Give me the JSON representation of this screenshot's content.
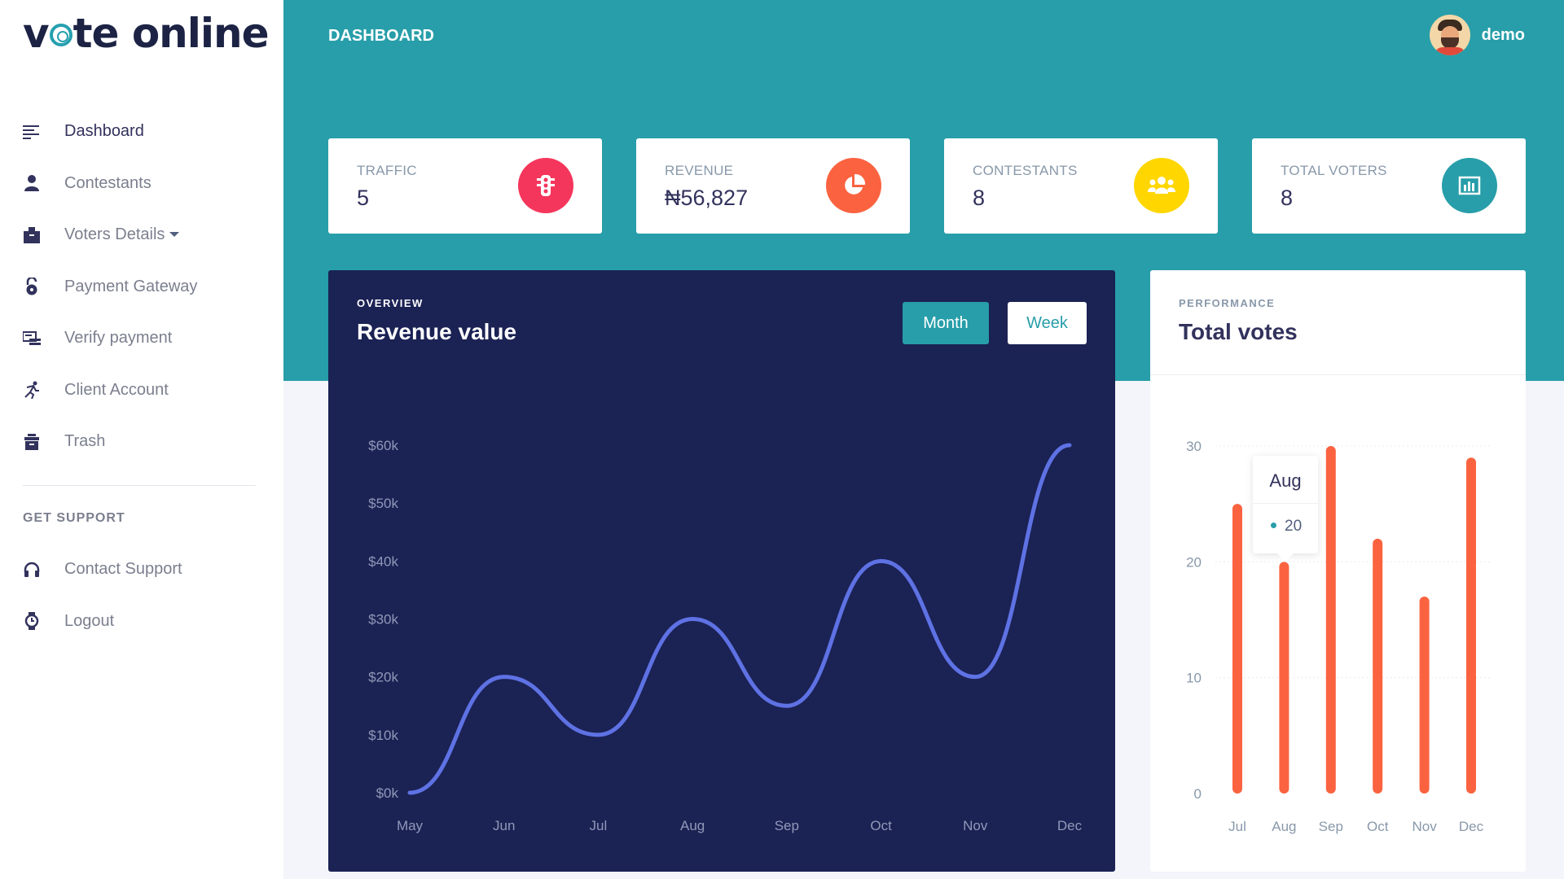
{
  "brand": {
    "prefix": "v",
    "suffix": "te online"
  },
  "sidebar": {
    "items": [
      {
        "label": "Dashboard",
        "icon": "list-icon"
      },
      {
        "label": "Contestants",
        "icon": "user-icon"
      },
      {
        "label": "Voters Details",
        "icon": "inbox-icon"
      },
      {
        "label": "Payment Gateway",
        "icon": "lock-icon"
      },
      {
        "label": "Verify payment",
        "icon": "money-check-icon"
      },
      {
        "label": "Client Account",
        "icon": "running-icon"
      },
      {
        "label": "Trash",
        "icon": "archive-icon"
      }
    ],
    "support_heading": "GET SUPPORT",
    "support_items": [
      {
        "label": "Contact Support",
        "icon": "headphones-icon"
      },
      {
        "label": "Logout",
        "icon": "watch-icon"
      }
    ]
  },
  "header": {
    "title": "DASHBOARD",
    "username": "demo"
  },
  "stats": [
    {
      "title": "TRAFFIC",
      "value": "5",
      "color": "#f5365c",
      "icon": "traffic-light-icon"
    },
    {
      "title": "REVENUE",
      "value": "₦56,827",
      "color": "#fb6340",
      "icon": "pie-chart-icon"
    },
    {
      "title": "CONTESTANTS",
      "value": "8",
      "color": "#ffd600",
      "icon": "users-icon"
    },
    {
      "title": "TOTAL VOTERS",
      "value": "8",
      "color": "#279ea9",
      "icon": "bar-chart-icon"
    }
  ],
  "overview": {
    "kicker": "OVERVIEW",
    "title": "Revenue value",
    "btn_month": "Month",
    "btn_week": "Week"
  },
  "performance": {
    "kicker": "PERFORMANCE",
    "title": "Total votes",
    "tooltip": {
      "label": "Aug",
      "value": "20"
    }
  },
  "colors": {
    "primary": "#279ea9",
    "line": "#5e72e4",
    "bars": "#fb6340",
    "dark_card": "#1b2254"
  },
  "chart_data": [
    {
      "type": "line",
      "x": [
        "May",
        "Jun",
        "Jul",
        "Aug",
        "Sep",
        "Oct",
        "Nov",
        "Dec"
      ],
      "y_ticks": [
        "$0k",
        "$10k",
        "$20k",
        "$30k",
        "$40k",
        "$50k",
        "$60k"
      ],
      "series": [
        {
          "values": [
            0,
            20,
            10,
            30,
            15,
            40,
            20,
            60
          ]
        }
      ],
      "ylim": [
        0,
        60
      ]
    },
    {
      "type": "bar",
      "categories": [
        "Jul",
        "Aug",
        "Sep",
        "Oct",
        "Nov",
        "Dec"
      ],
      "y_ticks": [
        "0",
        "10",
        "20",
        "30"
      ],
      "values": [
        25,
        20,
        30,
        22,
        17,
        29
      ],
      "ylim": [
        0,
        30
      ]
    }
  ]
}
